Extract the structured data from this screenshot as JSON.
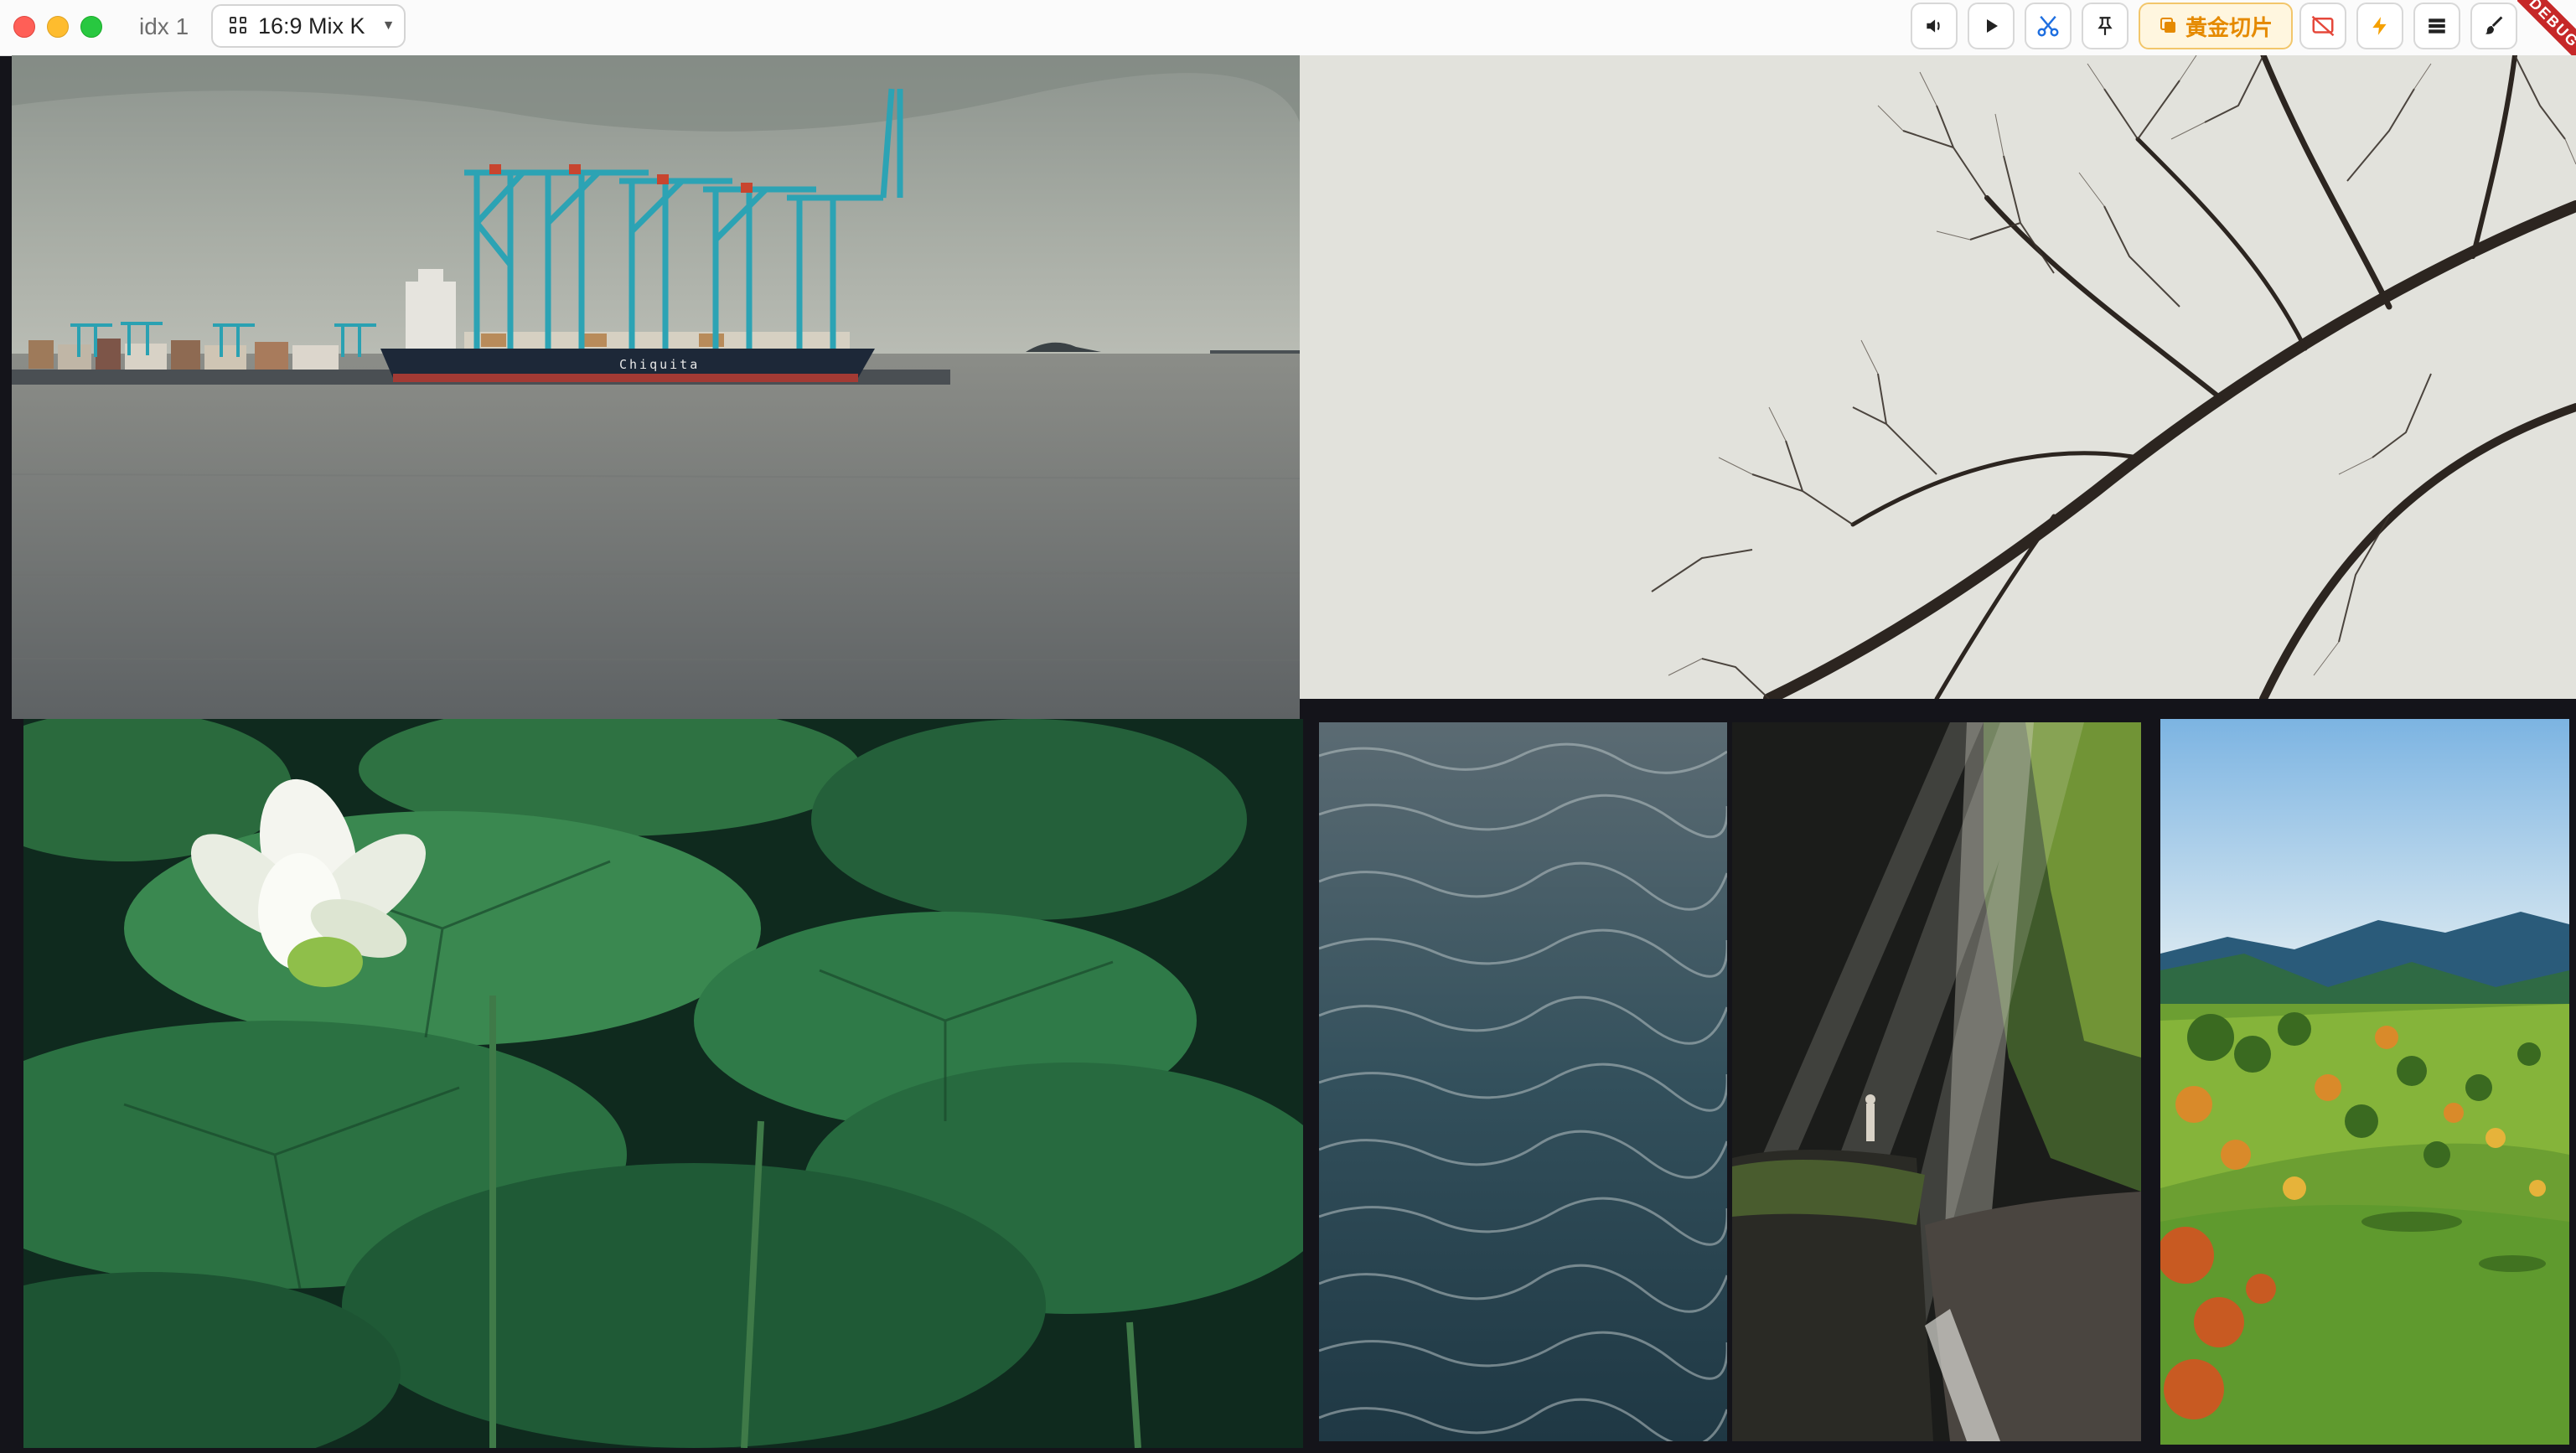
{
  "window": {
    "title": "idx 1",
    "layout_select": {
      "label": "16:9 Mix K"
    },
    "debug_banner": "DEBUG"
  },
  "toolbar": {
    "buttons": [
      {
        "name": "volume-button",
        "icon": "speaker-icon"
      },
      {
        "name": "play-button",
        "icon": "play-icon"
      },
      {
        "name": "cut-button",
        "icon": "scissors-icon",
        "color": "#1f6fe0"
      },
      {
        "name": "pin-button",
        "icon": "pin-icon"
      },
      {
        "name": "golden-cut-button",
        "icon": "copy-icon",
        "label": "黃金切片",
        "color": "#e58a00"
      },
      {
        "name": "screen-off-button",
        "icon": "screen-off-icon",
        "color": "#e5483b"
      },
      {
        "name": "flash-button",
        "icon": "lightning-icon",
        "color": "#f5a000"
      },
      {
        "name": "list-button",
        "icon": "list-icon"
      },
      {
        "name": "brush-button",
        "icon": "brush-icon"
      }
    ]
  },
  "tiles": [
    {
      "name": "tile-port-cranes",
      "ship_text": "Chiquita"
    },
    {
      "name": "tile-bare-tree"
    },
    {
      "name": "tile-lotus"
    },
    {
      "name": "tile-ocean-waves"
    },
    {
      "name": "tile-waterfall"
    },
    {
      "name": "tile-green-valley"
    }
  ],
  "colors": {
    "accent_gold": "#e58a00",
    "accent_blue": "#1f6fe0",
    "accent_red": "#e5483b",
    "background": "#14141a"
  }
}
